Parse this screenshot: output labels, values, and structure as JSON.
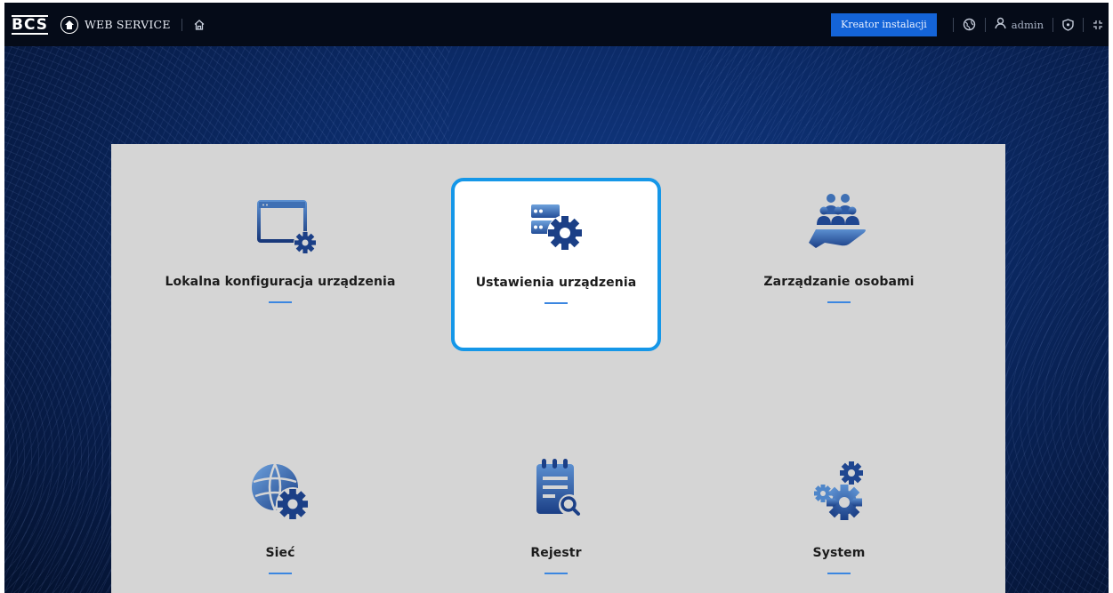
{
  "header": {
    "logo": "BCS",
    "service_label": "WEB SERVICE",
    "wizard_button": "Kreator instalacji",
    "user": "admin"
  },
  "icons": {
    "globe": "globe-icon",
    "home": "home-icon",
    "language": "language-icon",
    "user": "user-icon",
    "security": "shield-icon",
    "fullscreen": "fullscreen-icon"
  },
  "colors": {
    "accent": "#1464d8",
    "selection_border": "#1597e8",
    "icon_dark": "#1b3f86",
    "icon_light": "#4f86c9"
  },
  "tiles": [
    {
      "label": "Lokalna konfiguracja urządzenia",
      "icon": "local-config-icon",
      "active": false
    },
    {
      "label": "Ustawienia urządzenia",
      "icon": "device-settings-icon",
      "active": true
    },
    {
      "label": "Zarządzanie osobami",
      "icon": "people-management-icon",
      "active": false
    },
    {
      "label": "Sieć",
      "icon": "network-icon",
      "active": false
    },
    {
      "label": "Rejestr",
      "icon": "log-icon",
      "active": false
    },
    {
      "label": "System",
      "icon": "system-icon",
      "active": false
    }
  ]
}
